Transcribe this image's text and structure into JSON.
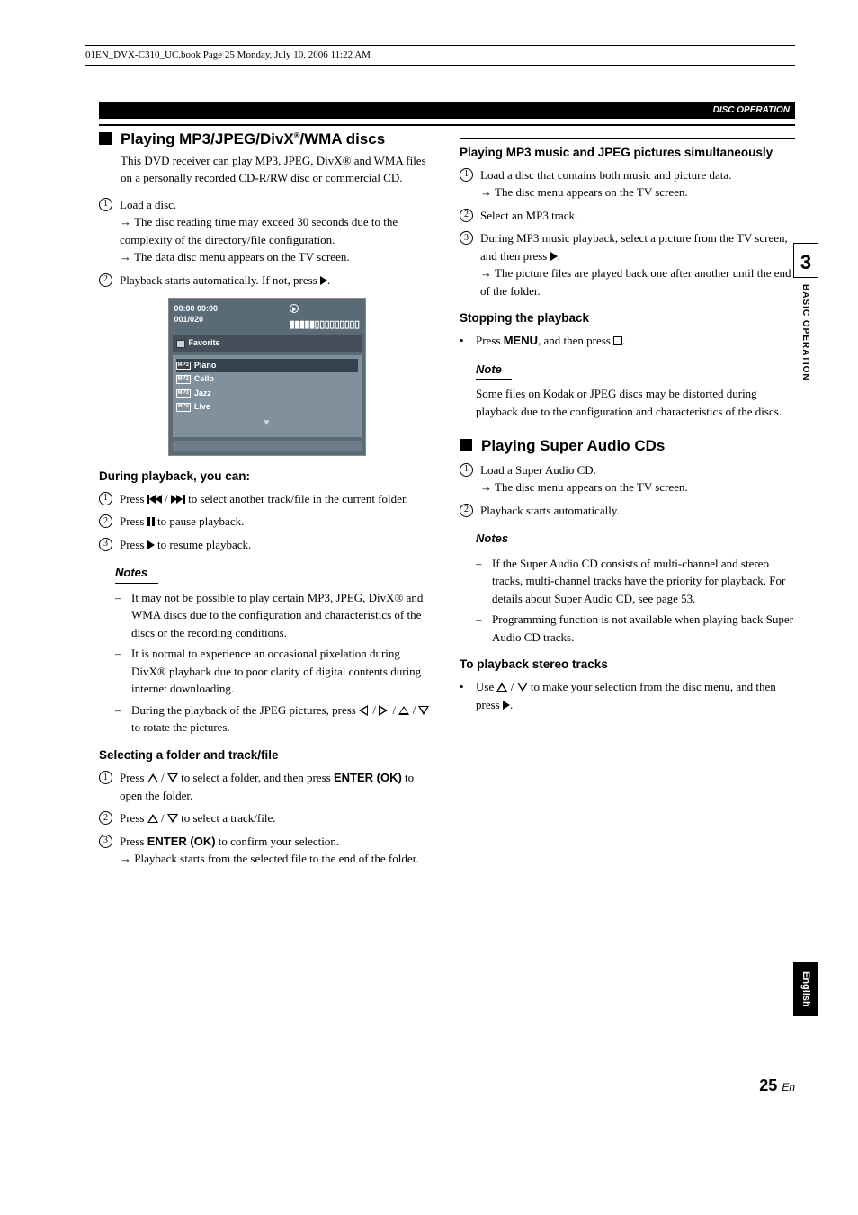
{
  "docHeader": "01EN_DVX-C310_UC.book  Page 25  Monday, July 10, 2006  11:22 AM",
  "sectionTag": "DISC OPERATION",
  "chapterNum": "3",
  "chapterLabel": "BASIC OPERATION",
  "langTab": "English",
  "pageNum": "25",
  "pageSuffix": "En",
  "left": {
    "h1a": "Playing MP3/JPEG/DivX",
    "h1b": "/WMA discs",
    "intro": "This DVD receiver can play MP3, JPEG, DivX® and WMA files on a personally recorded CD-R/RW disc or commercial CD.",
    "step1": "Load a disc.",
    "step1a": "The disc reading time may exceed 30 seconds due to the complexity of the directory/file configuration.",
    "step1b": "The data disc menu appears on the TV screen.",
    "step2pre": "Playback starts automatically. If not, press ",
    "step2post": ".",
    "tv": {
      "time": "00:00   00:00",
      "counter": "001/020",
      "folder": "Favorite",
      "tracks": [
        "Piano",
        "Cello",
        "Jazz",
        "Live"
      ],
      "tag": "MP3",
      "bars": "▮▮▮▮▮▯▯▯▯▯▯▯▯▯"
    },
    "h3a": "During playback, you can:",
    "d1pre": "Press ",
    "d1post": " to select another track/file in the current folder.",
    "d2pre": "Press ",
    "d2post": " to pause playback.",
    "d3pre": "Press ",
    "d3post": " to resume playback.",
    "notesLabel1": "Notes",
    "n1": "It may not be possible to play certain MP3, JPEG, DivX® and WMA discs due to the configuration and characteristics of the discs or the recording conditions.",
    "n2": "It is normal to experience an occasional pixelation during DivX® playback due to poor clarity of digital contents during internet downloading.",
    "n3pre": "During the playback of the JPEG pictures, press ",
    "n3post": " to rotate the pictures.",
    "h3b": "Selecting a folder and track/file",
    "s1pre": "Press ",
    "s1mid": " to select a folder, and then press ",
    "s1b": "ENTER (OK)",
    "s1post": " to open the folder.",
    "s2pre": "Press ",
    "s2post": " to select a track/file.",
    "s3pre": "Press ",
    "s3b": "ENTER (OK)",
    "s3mid": " to confirm your selection.",
    "s3arrow": "Playback starts from the selected file to the end of the folder."
  },
  "right": {
    "h3a": "Playing MP3 music and JPEG pictures simultaneously",
    "r1": "Load a disc that contains both music and picture data.",
    "r1a": "The disc menu appears on the TV screen.",
    "r2": "Select an MP3 track.",
    "r3pre": "During MP3 music playback, select a picture from the TV screen, and then press ",
    "r3post": ".",
    "r3arrow": "The picture files are played back one after another until the end of the folder.",
    "h3b": "Stopping the playback",
    "stop_pre": "Press ",
    "stop_b": "MENU",
    "stop_mid": ", and then press ",
    "stop_post": ".",
    "noteLabel": "Note",
    "note1": "Some files on Kodak or JPEG discs may be distorted during playback due to the configuration and characteristics of the discs.",
    "h2": "Playing Super Audio CDs",
    "sa1": "Load a Super Audio CD.",
    "sa1a": "The disc menu appears on the TV screen.",
    "sa2": "Playback starts automatically.",
    "notesLabel2": "Notes",
    "sn1": "If the Super Audio CD consists of multi-channel and stereo tracks, multi-channel tracks have the priority for playback. For details about Super Audio CD, see page 53.",
    "sn2": "Programming function is not available when playing back Super Audio CD tracks.",
    "h3c": "To playback stereo tracks",
    "st_pre": "Use ",
    "st_mid": " to make your selection from the disc menu, and then press ",
    "st_post": "."
  }
}
